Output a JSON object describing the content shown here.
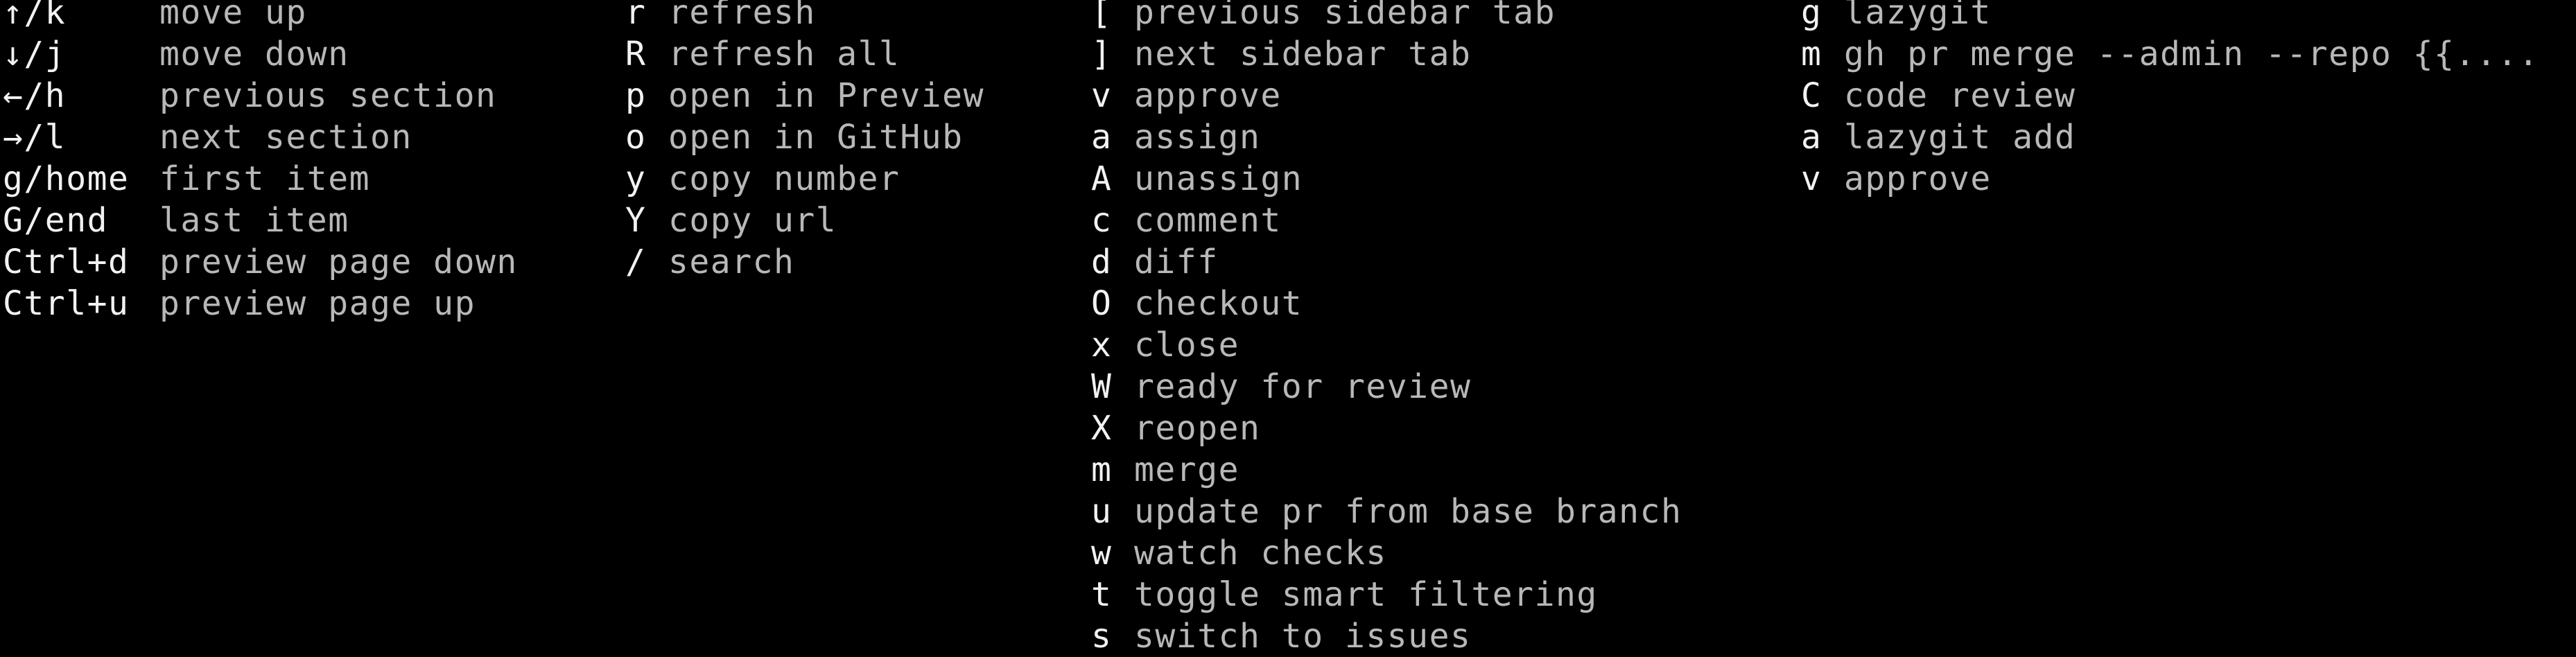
{
  "colors": {
    "background": "#000000",
    "key_text": "#f2f2f2",
    "description_text": "#b8b8b8"
  },
  "columns": [
    {
      "rows": [
        {
          "key": "↑/k",
          "desc": "move up"
        },
        {
          "key": "↓/j",
          "desc": "move down"
        },
        {
          "key": "←/h",
          "desc": "previous section"
        },
        {
          "key": "→/l",
          "desc": "next section"
        },
        {
          "key": "g/home",
          "desc": "first item"
        },
        {
          "key": "G/end",
          "desc": "last item"
        },
        {
          "key": "Ctrl+d",
          "desc": "preview page down"
        },
        {
          "key": "Ctrl+u",
          "desc": "preview page up"
        }
      ]
    },
    {
      "rows": [
        {
          "key": "r",
          "desc": "refresh"
        },
        {
          "key": "R",
          "desc": "refresh all"
        },
        {
          "key": "p",
          "desc": "open in Preview"
        },
        {
          "key": "o",
          "desc": "open in GitHub"
        },
        {
          "key": "y",
          "desc": "copy number"
        },
        {
          "key": "Y",
          "desc": "copy url"
        },
        {
          "key": "/",
          "desc": "search"
        }
      ]
    },
    {
      "rows": [
        {
          "key": "[",
          "desc": "previous sidebar tab"
        },
        {
          "key": "]",
          "desc": "next sidebar tab"
        },
        {
          "key": "v",
          "desc": "approve"
        },
        {
          "key": "a",
          "desc": "assign"
        },
        {
          "key": "A",
          "desc": "unassign"
        },
        {
          "key": "c",
          "desc": "comment"
        },
        {
          "key": "d",
          "desc": "diff"
        },
        {
          "key": "O",
          "desc": "checkout"
        },
        {
          "key": "x",
          "desc": "close"
        },
        {
          "key": "W",
          "desc": "ready for review"
        },
        {
          "key": "X",
          "desc": "reopen"
        },
        {
          "key": "m",
          "desc": "merge"
        },
        {
          "key": "u",
          "desc": "update pr from base branch"
        },
        {
          "key": "w",
          "desc": "watch checks"
        },
        {
          "key": "t",
          "desc": "toggle smart filtering"
        },
        {
          "key": "s",
          "desc": "switch to issues"
        }
      ]
    },
    {
      "rows": [
        {
          "key": "g",
          "desc": "lazygit"
        },
        {
          "key": "m",
          "desc": "gh pr merge --admin --repo {{...."
        },
        {
          "key": "C",
          "desc": "code review"
        },
        {
          "key": "a",
          "desc": "lazygit add"
        },
        {
          "key": "v",
          "desc": "approve"
        }
      ]
    }
  ]
}
